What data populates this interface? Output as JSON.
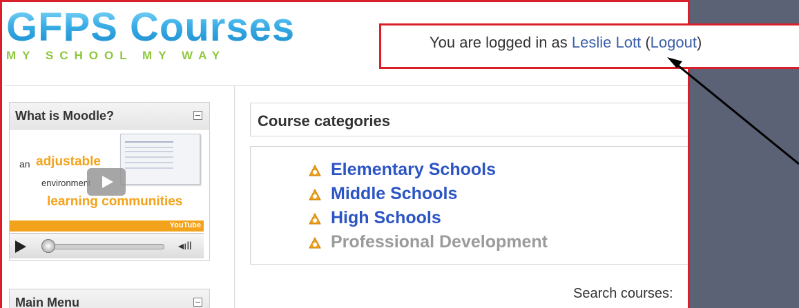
{
  "colors": {
    "accent_red": "#d81f2a",
    "link_blue": "#2b55c4",
    "login_link": "#3b5ea8",
    "logo_blue": "#3aaee6",
    "tagline_green": "#8fc73e",
    "video_orange": "#f3a31b",
    "dimmed": "#9b9b9b",
    "background": "#5b6275"
  },
  "header": {
    "logo_title": "GFPS Courses",
    "logo_tagline": "MY SCHOOL MY WAY"
  },
  "login": {
    "prefix": "You are logged in as ",
    "user_name": "Leslie Lott",
    "open_paren": " (",
    "logout_label": "Logout",
    "close_paren": ")"
  },
  "sidebar": {
    "what_is_moodle": {
      "title": "What is Moodle?",
      "video": {
        "word_an": "an",
        "word_adjustable": "adjustable",
        "word_environment": "environment",
        "word_learning": "learning communities",
        "brand": "YouTube"
      }
    },
    "main_menu": {
      "title": "Main Menu"
    }
  },
  "main": {
    "categories_title": "Course categories",
    "categories": [
      {
        "label": "Elementary Schools",
        "dimmed": false
      },
      {
        "label": "Middle Schools",
        "dimmed": false
      },
      {
        "label": "High Schools",
        "dimmed": false
      },
      {
        "label": "Professional Development",
        "dimmed": true
      }
    ],
    "search_label": "Search courses:"
  },
  "icons": {
    "category": "category-icon",
    "collapse": "collapse-icon",
    "play": "play-icon",
    "volume": "volume-icon"
  }
}
